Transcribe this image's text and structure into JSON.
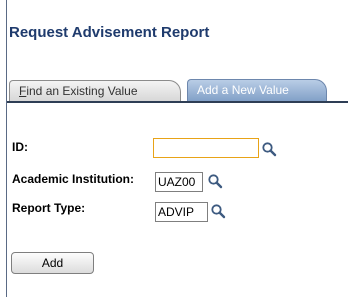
{
  "page": {
    "title": "Request Advisement Report"
  },
  "tabs": {
    "find_existing": {
      "accesskey": "F",
      "label_rest": "ind an Existing Value"
    },
    "add_new": {
      "label": "Add a New Value"
    }
  },
  "form": {
    "id": {
      "label": "ID:",
      "value": ""
    },
    "academic_institution": {
      "label": "Academic Institution:",
      "value": "UAZ00"
    },
    "report_type": {
      "label": "Report Type:",
      "value": "ADVIP"
    }
  },
  "actions": {
    "add_label": "Add"
  },
  "icons": {
    "lookup": "magnifying-glass-icon"
  },
  "colors": {
    "title": "#1f3b6d",
    "active_tab": "#7f9ec6",
    "focus_border": "#e8a317"
  }
}
